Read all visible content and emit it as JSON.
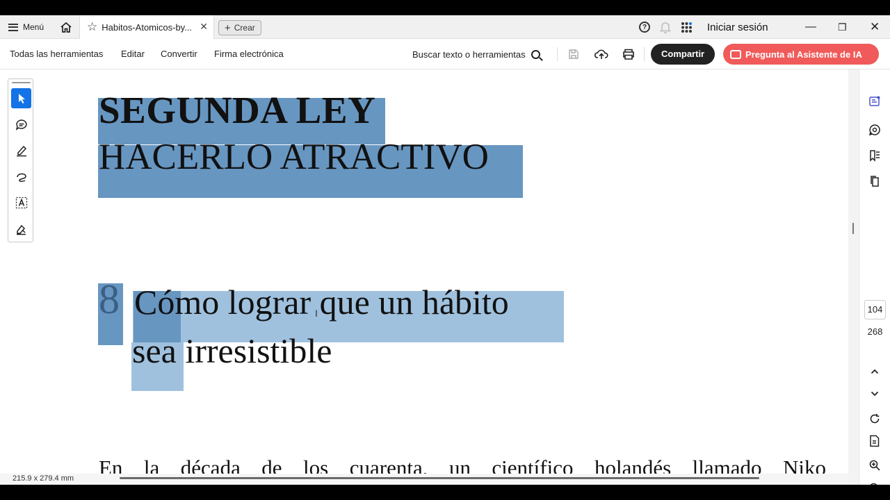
{
  "tabbar": {
    "menu_label": "Menú",
    "tab_title": "Habitos-Atomicos-by...",
    "create_label": "Crear",
    "signin_label": "Iniciar sesión"
  },
  "toolbar": {
    "all_tools": "Todas las herramientas",
    "edit": "Editar",
    "convert": "Convertir",
    "esign": "Firma electrónica",
    "search_placeholder": "Buscar texto o herramientas",
    "share_label": "Compartir",
    "ai_label": "Pregunta al Asistente de IA"
  },
  "document": {
    "law_title": "SEGUNDA LEY",
    "law_subtitle": "HACERLO ATRACTIVO",
    "chapter_number": "8",
    "chapter_title_line1": "Cómo lograr que un hábito",
    "chapter_title_line2": "sea irresistible",
    "body_first_line": "En la década de los cuarenta, un científico holandés llamado Niko"
  },
  "status": {
    "page_size": "215.9 x 279.4 mm"
  },
  "page_nav": {
    "current_page": "104",
    "total_pages": "268"
  },
  "colors": {
    "accent_blue": "#1473e6",
    "share_button": "#222222",
    "ai_button": "#f05a5a",
    "highlight_dark": "#6796c1",
    "highlight_light": "#9fc1de"
  },
  "icons": {
    "left_tools": [
      "select-arrow-icon",
      "comment-icon",
      "highlight-pen-icon",
      "draw-freehand-icon",
      "text-select-icon",
      "sign-icon"
    ],
    "right_rail": [
      "ai-assistant-panel-icon",
      "comments-panel-icon",
      "bookmarks-icon",
      "pages-thumbnails-icon",
      "chevron-up-icon",
      "chevron-down-icon",
      "rotate-icon",
      "page-info-icon",
      "zoom-in-icon",
      "zoom-out-icon"
    ]
  }
}
